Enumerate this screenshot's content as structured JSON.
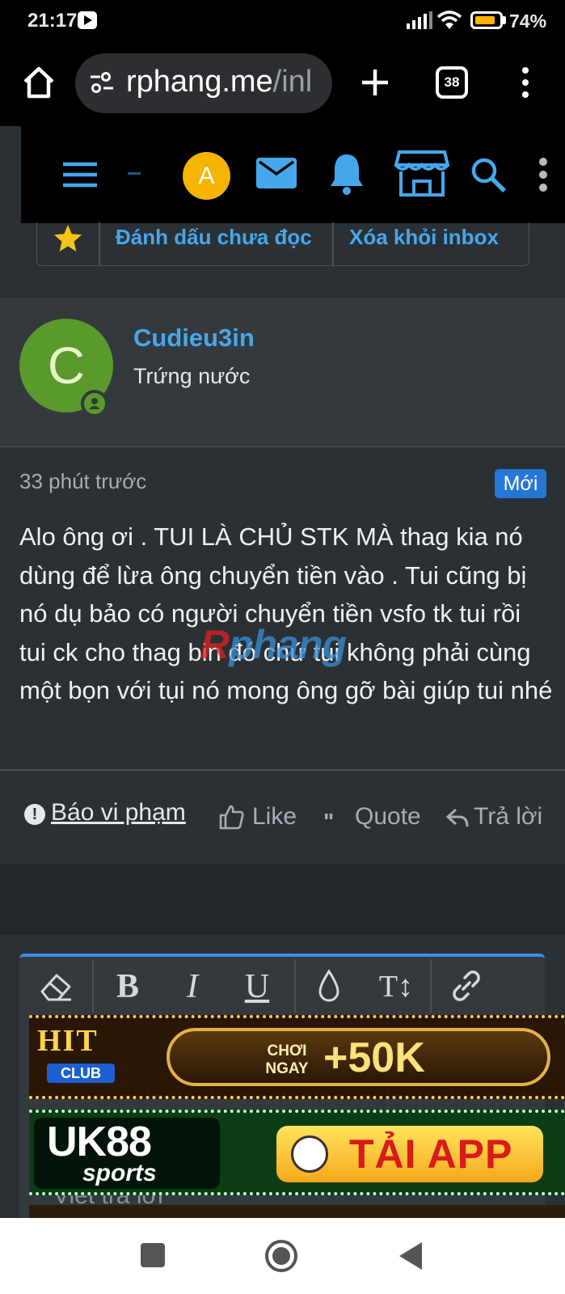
{
  "status_bar": {
    "time": "21:17",
    "battery_percent": "74%",
    "battery_level": 0.74,
    "battery_color": "#ffb300"
  },
  "browser": {
    "url_host": "rphang.me",
    "url_path": "/inl",
    "tab_count": "38",
    "icons": [
      "home-icon",
      "site-settings-icon",
      "new-tab-icon",
      "tabs-icon",
      "menu-icon"
    ]
  },
  "site_header": {
    "avatar_letter": "A",
    "avatar_color": "#f5b400",
    "icon_color": "#47a7eb",
    "icons": [
      "hamburger-icon",
      "mail-icon",
      "bell-icon",
      "store-icon",
      "search-icon",
      "more-icon"
    ]
  },
  "actions": {
    "mark_unread": "Đánh dấu chưa đọc",
    "remove_inbox": "Xóa khỏi inbox"
  },
  "author": {
    "avatar_letter": "C",
    "avatar_color": "#5a9a2c",
    "name": "Cudieu3in",
    "title": "Trứng nước"
  },
  "message": {
    "time": "33 phút trước",
    "new_badge": "Mới",
    "body": "Alo ông ơi . TUI LÀ CHỦ STK MÀ thag kia nó dùng để lừa ông chuyển tiền vào . Tui cũng bị nó dụ bảo có người chuyển tiền vsfo tk tui rồi tui ck cho thag bin đó chứ tui không phải cùng một bọn với tụi nó mong ông gỡ bài giúp tui nhé",
    "watermark_part1": "R",
    "watermark_part2": "phang"
  },
  "footer": {
    "report": "Báo vi phạm",
    "like": "Like",
    "quote": "Quote",
    "reply": "Trả lời"
  },
  "editor": {
    "toolbar": [
      "eraser-icon",
      "bold-icon",
      "italic-icon",
      "underline-icon",
      "color-icon",
      "text-size-icon",
      "link-icon"
    ],
    "bold": "B",
    "italic": "I",
    "underline": "U",
    "text_size": "T↕",
    "placeholder": "Viết trả lời"
  },
  "ads": {
    "ad1": {
      "logo_top": "HIT",
      "logo_bottom": "CLUB",
      "cta_small": "CHƠI NGAY",
      "cta_big": "+50K"
    },
    "ad2": {
      "logo_top": "UK88",
      "logo_bottom": "sports",
      "cta": "TẢI APP"
    }
  }
}
